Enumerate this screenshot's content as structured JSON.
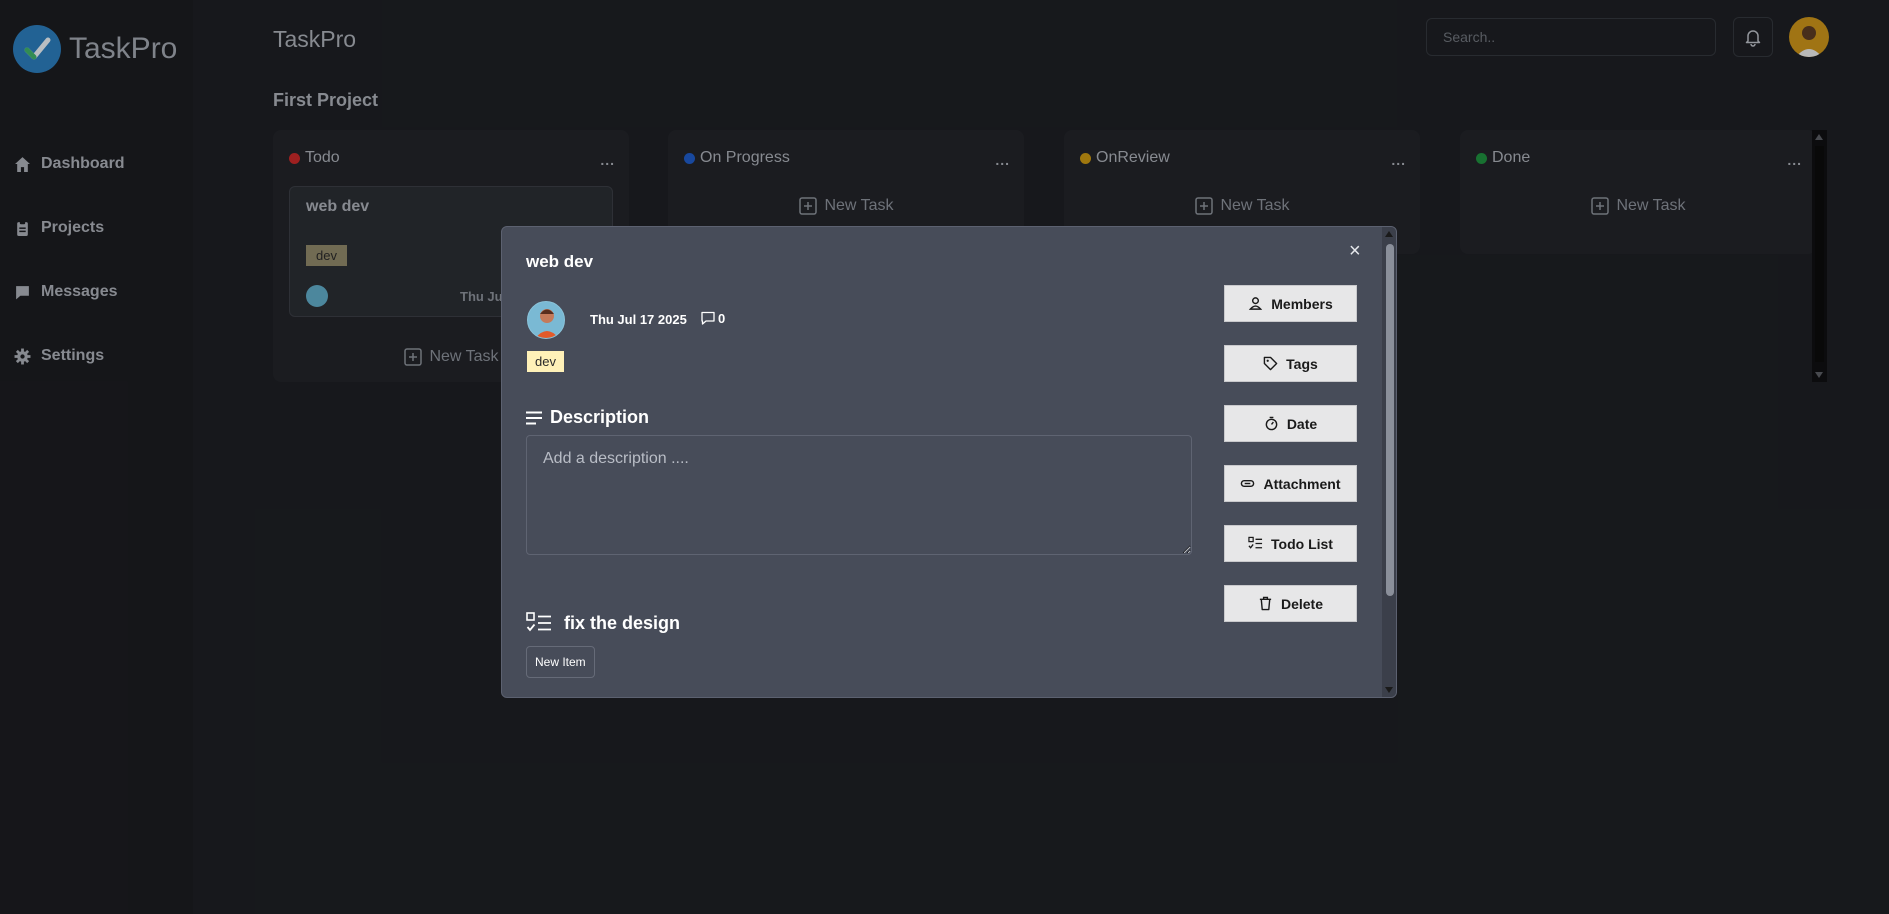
{
  "app": {
    "name": "TaskPro"
  },
  "sidebar": {
    "items": [
      {
        "label": "Dashboard",
        "icon": "home-icon"
      },
      {
        "label": "Projects",
        "icon": "clipboard-icon"
      },
      {
        "label": "Messages",
        "icon": "message-icon"
      },
      {
        "label": "Settings",
        "icon": "gear-icon"
      }
    ]
  },
  "header": {
    "title": "TaskPro",
    "search_placeholder": "Search.."
  },
  "project": {
    "title": "First Project"
  },
  "columns": [
    {
      "title": "Todo",
      "color": "#c62828",
      "menu": "...",
      "new_task": "New Task"
    },
    {
      "title": "On Progress",
      "color": "#1e5bc6",
      "menu": "...",
      "new_task": "New Task"
    },
    {
      "title": "OnReview",
      "color": "#c79512",
      "menu": "...",
      "new_task": "New Task"
    },
    {
      "title": "Done",
      "color": "#1e8e3e",
      "menu": "...",
      "new_task": "New Task"
    }
  ],
  "card": {
    "title": "web dev",
    "tag": "dev",
    "date": "Thu Ju"
  },
  "modal": {
    "title": "web dev",
    "close": "×",
    "date": "Thu Jul 17 2025",
    "comments": "0",
    "tag": "dev",
    "description_heading": "Description",
    "description_placeholder": "Add a description ....",
    "todo_heading": "fix the design",
    "new_item": "New Item",
    "buttons": [
      {
        "label": "Members",
        "icon": "user-icon"
      },
      {
        "label": "Tags",
        "icon": "tag-icon"
      },
      {
        "label": "Date",
        "icon": "stopwatch-icon"
      },
      {
        "label": "Attachment",
        "icon": "paperclip-icon"
      },
      {
        "label": "Todo List",
        "icon": "checklist-icon"
      },
      {
        "label": "Delete",
        "icon": "trash-icon"
      }
    ]
  },
  "colors": {
    "background": "#1d1f23",
    "modal": "#474c59",
    "accent": "#2b7bb9"
  }
}
